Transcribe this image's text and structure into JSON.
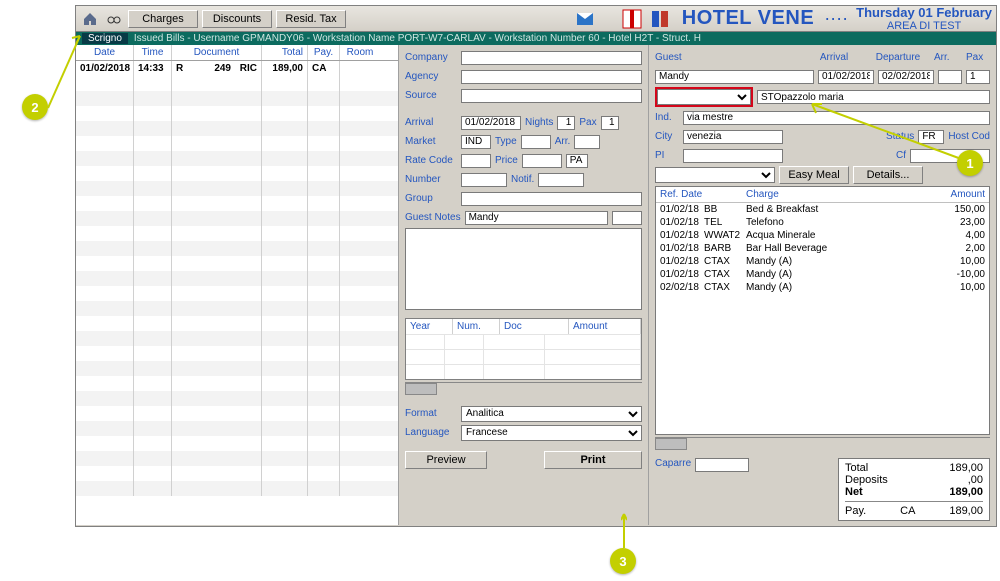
{
  "toolbar": {
    "charges": "Charges",
    "discounts": "Discounts",
    "resid_tax": "Resid. Tax"
  },
  "header": {
    "title": "HOTEL VENE",
    "dots": "····",
    "date_line": "Thursday 01 February",
    "sub_line": "AREA DI TEST"
  },
  "status": {
    "brand": "Scrigno",
    "text": "Issued Bills - Username GPMANDY06 -  Workstation Name PORT-W7-CARLAV -  Workstation Number 60 -  Hotel H2T -  Struct. H"
  },
  "left_table": {
    "head": {
      "date": "Date",
      "time": "Time",
      "document": "Document",
      "total": "Total",
      "pay": "Pay.",
      "room": "Room"
    },
    "row": {
      "date": "01/02/2018",
      "time": "14:33",
      "doc_a": "R",
      "doc_b": "249",
      "doc_c": "RIC",
      "total": "189,00",
      "pay": "CA",
      "room": ""
    }
  },
  "mid": {
    "company": "Company",
    "agency": "Agency",
    "source": "Source",
    "arrival": "Arrival",
    "arrival_val": "01/02/2018",
    "nights": "Nights",
    "nights_val": "1",
    "pax": "Pax",
    "pax_val": "1",
    "market": "Market",
    "market_val": "IND",
    "type": "Type",
    "arr": "Arr.",
    "rate_code": "Rate Code",
    "price": "Price",
    "pa": "PA",
    "number": "Number",
    "notif": "Notif.",
    "group": "Group",
    "guest_notes": "Guest Notes",
    "guest_notes_val": "Mandy",
    "mini_head": {
      "year": "Year",
      "num": "Num.",
      "doc": "Doc",
      "amount": "Amount"
    },
    "format": "Format",
    "format_val": "Analitica",
    "language": "Language",
    "language_val": "Francese",
    "preview": "Preview",
    "print": "Print"
  },
  "right": {
    "guest_lbl": "Guest",
    "arrival_lbl": "Arrival",
    "departure_lbl": "Departure",
    "arr_lbl": "Arr.",
    "pax_lbl": "Pax",
    "guest_val": "Mandy",
    "arrival_val": "01/02/2018",
    "departure_val": "02/02/2018",
    "pax_val": "1",
    "second_guest": "STOpazzolo maria",
    "ind": "Ind.",
    "ind_val": "via mestre",
    "city": "City",
    "city_val": "venezia",
    "status": "Status",
    "status_val": "FR",
    "host": "Host Cod",
    "pi": "PI",
    "cf": "Cf",
    "easy_meal": "Easy Meal",
    "details": "Details...",
    "charges_head": {
      "ref_date": "Ref. Date",
      "charge": "Charge",
      "amount": "Amount"
    },
    "charges": [
      {
        "date": "01/02/18",
        "code": "BB",
        "desc": "Bed & Breakfast",
        "amt": "150,00"
      },
      {
        "date": "01/02/18",
        "code": "TEL",
        "desc": "Telefono",
        "amt": "23,00"
      },
      {
        "date": "01/02/18",
        "code": "WWAT2",
        "desc": "Acqua Minerale",
        "amt": "4,00"
      },
      {
        "date": "01/02/18",
        "code": "BARB",
        "desc": "Bar Hall Beverage",
        "amt": "2,00"
      },
      {
        "date": "01/02/18",
        "code": "CTAX",
        "desc": "Mandy (A)",
        "amt": "10,00"
      },
      {
        "date": "01/02/18",
        "code": "CTAX",
        "desc": "Mandy (A)",
        "amt": "-10,00"
      },
      {
        "date": "02/02/18",
        "code": "CTAX",
        "desc": "Mandy (A)",
        "amt": "10,00"
      }
    ],
    "caparre": "Caparre",
    "totals": {
      "total_lbl": "Total",
      "total": "189,00",
      "deposits_lbl": "Deposits",
      "deposits": ",00",
      "net_lbl": "Net",
      "net": "189,00",
      "pay_lbl": "Pay.",
      "pay_code": "CA",
      "pay_amt": "189,00"
    }
  },
  "annotations": {
    "one": "1",
    "two": "2",
    "three": "3"
  }
}
